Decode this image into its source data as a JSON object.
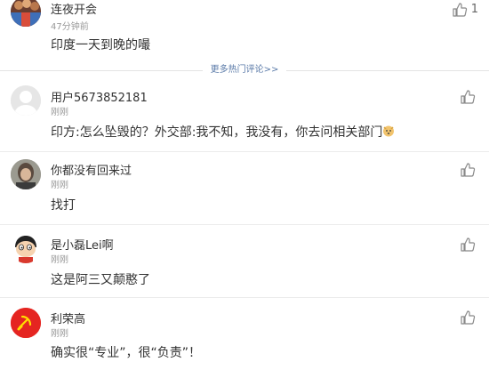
{
  "more_hot_label": "更多热门评论>>",
  "comments": [
    {
      "username": "连夜开会",
      "time": "47分钟前",
      "text": "印度一天到晚的嘬",
      "likes": "1",
      "avatar_icon": "crowd-photo-avatar"
    },
    {
      "username": "用户5673852181",
      "time": "刚刚",
      "text": "印方:怎么坠毁的？外交部:我不知，我没有，你去问相关部门",
      "likes": "",
      "avatar_icon": "default-user-avatar"
    },
    {
      "username": "你都没有回来过",
      "time": "刚刚",
      "text": "找打",
      "likes": "",
      "avatar_icon": "photo-avatar"
    },
    {
      "username": "是小磊Lei啊",
      "time": "刚刚",
      "text": "这是阿三又颠憨了",
      "likes": "",
      "avatar_icon": "cartoon-boy-avatar"
    },
    {
      "username": "利荣高",
      "time": "刚刚",
      "text": "确实很“专业”，很“负责”！",
      "likes": "",
      "avatar_icon": "red-flag-avatar"
    }
  ],
  "colors": {
    "link": "#5a7aa8",
    "meta": "#999999",
    "text": "#333333"
  }
}
